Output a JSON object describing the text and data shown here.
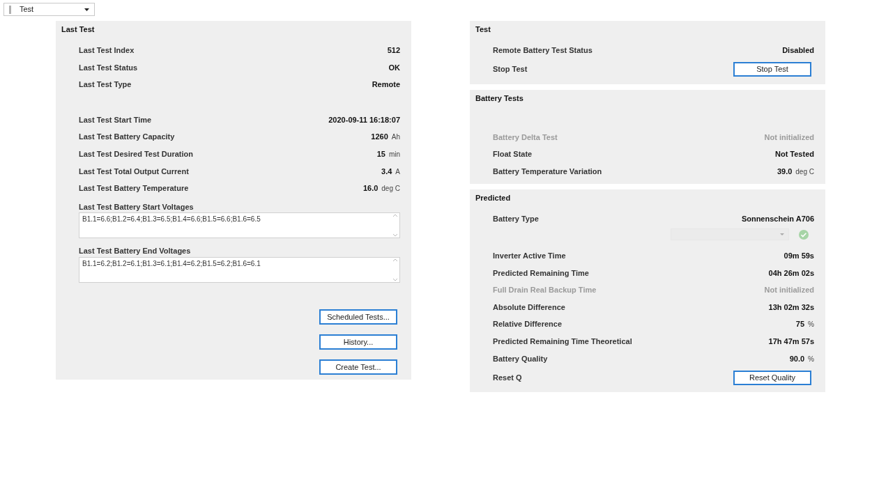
{
  "selector": {
    "value": "Test"
  },
  "left_panel": {
    "title": "Last Test",
    "rows": [
      {
        "kind": "value",
        "label": "Last Test Index",
        "value": "512",
        "disabled": false
      },
      {
        "kind": "value",
        "label": "Last Test Status",
        "value": "OK",
        "disabled": false
      },
      {
        "kind": "value",
        "label": "Last Test Type",
        "value": "Remote",
        "disabled": false
      },
      {
        "kind": "value",
        "label": "Last Test Start Time",
        "value": "2020-09-11 16:18:07",
        "disabled": false
      },
      {
        "kind": "value",
        "label": "Last Test Battery Capacity",
        "value": "1260",
        "unit": "Ah",
        "disabled": false
      },
      {
        "kind": "value",
        "label": "Last Test Desired Test Duration",
        "value": "15",
        "unit": "min",
        "disabled": false
      },
      {
        "kind": "value",
        "label": "Last Test Total Output Current",
        "value": "3.4",
        "unit": "A",
        "disabled": false
      },
      {
        "kind": "value",
        "label": "Last Test Battery Temperature",
        "value": "16.0",
        "unit": "deg C",
        "disabled": false
      },
      {
        "kind": "textarea",
        "label": "Last Test Battery Start Voltages",
        "value": "B1.1=6.6;B1.2=6.4;B1.3=6.5;B1.4=6.6;B1.5=6.6;B1.6=6.5"
      },
      {
        "kind": "textarea",
        "label": "Last Test Battery End Voltages",
        "value": "B1.1=6.2;B1.2=6.1;B1.3=6.1;B1.4=6.2;B1.5=6.2;B1.6=6.1"
      }
    ],
    "buttons": [
      "Scheduled Tests...",
      "History...",
      "Create Test..."
    ]
  },
  "right_panels": [
    {
      "title": "Test",
      "rows": [
        {
          "kind": "value",
          "label": "Remote Battery Test Status",
          "value": "Disabled",
          "disabled": false
        },
        {
          "kind": "button",
          "label": "Stop Test",
          "button": "Stop Test"
        }
      ]
    },
    {
      "title": "Battery Tests",
      "rows": [
        {
          "kind": "value",
          "label": "Battery Delta Test",
          "value": "Not initialized",
          "disabled": true
        },
        {
          "kind": "value",
          "label": "Float State",
          "value": "Not Tested",
          "disabled": false
        },
        {
          "kind": "value",
          "label": "Battery Temperature Variation",
          "value": "39.0",
          "unit": "deg C",
          "disabled": false
        }
      ]
    },
    {
      "title": "Predicted",
      "rows": [
        {
          "kind": "value",
          "label": "Battery Type",
          "value": "Sonnenschein A706",
          "disabled": false
        },
        {
          "kind": "dropdown",
          "disabled": true
        },
        {
          "kind": "value",
          "label": "Inverter Active Time",
          "value": "09m 59s",
          "disabled": false
        },
        {
          "kind": "value",
          "label": "Predicted Remaining Time",
          "value": "04h 26m 02s",
          "disabled": false
        },
        {
          "kind": "value",
          "label": "Full Drain Real Backup Time",
          "value": "Not initialized",
          "disabled": true
        },
        {
          "kind": "value",
          "label": "Absolute Difference",
          "value": "13h 02m 32s",
          "disabled": false
        },
        {
          "kind": "value",
          "label": "Relative Difference",
          "value": "75",
          "unit": "%",
          "disabled": false
        },
        {
          "kind": "value",
          "label": "Predicted Remaining Time Theoretical",
          "value": "17h 47m 57s",
          "disabled": false
        },
        {
          "kind": "value",
          "label": "Battery Quality",
          "value": "90.0",
          "unit": "%",
          "disabled": false
        },
        {
          "kind": "button",
          "label": "Reset Q",
          "button": "Reset Quality"
        }
      ]
    }
  ]
}
